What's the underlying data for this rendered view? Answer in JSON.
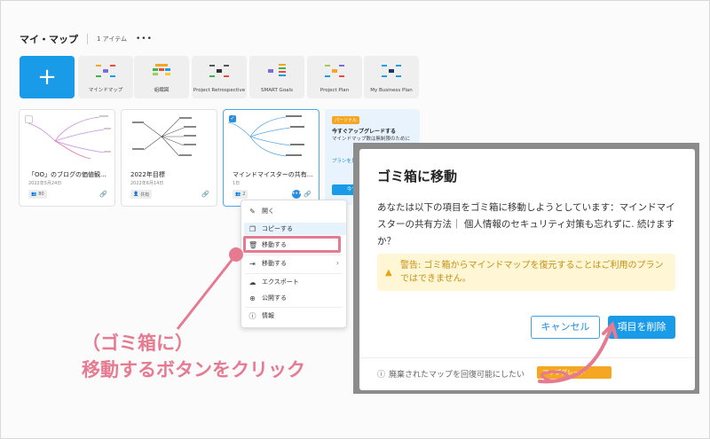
{
  "header": {
    "title": "マイ・マップ",
    "count": "1 アイテム",
    "more": "•••"
  },
  "new_button": {
    "label": "+"
  },
  "templates": [
    {
      "label": "マインドマップ",
      "icon": "mindmap-icon"
    },
    {
      "label": "組織図",
      "icon": "org-chart-icon"
    },
    {
      "label": "Project Retrospective",
      "icon": "retrospective-icon"
    },
    {
      "label": "SMART Goals",
      "icon": "smart-goals-icon"
    },
    {
      "label": "Project Plan",
      "icon": "project-plan-icon"
    },
    {
      "label": "My Business Plan",
      "icon": "business-plan-icon"
    }
  ],
  "cards": [
    {
      "name": "「OO」のブログの価値観...",
      "date": "2022年5月24日",
      "chip": "80",
      "checked": false
    },
    {
      "name": "2022年目標",
      "date": "2022年6月14日",
      "chip": "共有",
      "checked": false
    },
    {
      "name": "マインドマイスターの共有...",
      "date": "1日",
      "chip": "2",
      "checked": true
    }
  ],
  "promo": {
    "badge": "パーソナル",
    "heading": "今すぐアップグレードする",
    "text": "マインドマップ数は無制限のために",
    "link": "プランを見る",
    "button": "今すぐ"
  },
  "context_menu": {
    "items": [
      {
        "label": "開く",
        "icon": "pencil-icon"
      },
      {
        "label": "コピーする",
        "icon": "copy-icon"
      },
      {
        "label": "移動する",
        "icon": "trash-icon"
      },
      {
        "label": "移動する",
        "icon": "move-icon"
      },
      {
        "label": "エクスポート",
        "icon": "export-icon"
      },
      {
        "label": "公開する",
        "icon": "globe-icon"
      },
      {
        "label": "情報",
        "icon": "info-icon"
      }
    ]
  },
  "callout": {
    "line1": "（ゴミ箱に）",
    "line2": "移動するボタンをクリック"
  },
  "dialog": {
    "title": "ゴミ箱に移動",
    "body": "あなたは以下の項目をゴミ箱に移動しようとしています：マインドマイスターの共有方法｜ 個人情報のセキュリティ対策も忘れずに. 続けますか？",
    "warning": "警告: ゴミ箱からマインドマップを復元することはご利用のプランではできません。",
    "cancel": "キャンセル",
    "delete": "項目を削除",
    "footer": "廃棄されたマップを回復可能にしたい",
    "footer_badge": "アップグレード"
  },
  "colors": {
    "accent": "#1a9be8",
    "annotation": "#e57a91",
    "warning": "#c79010"
  }
}
